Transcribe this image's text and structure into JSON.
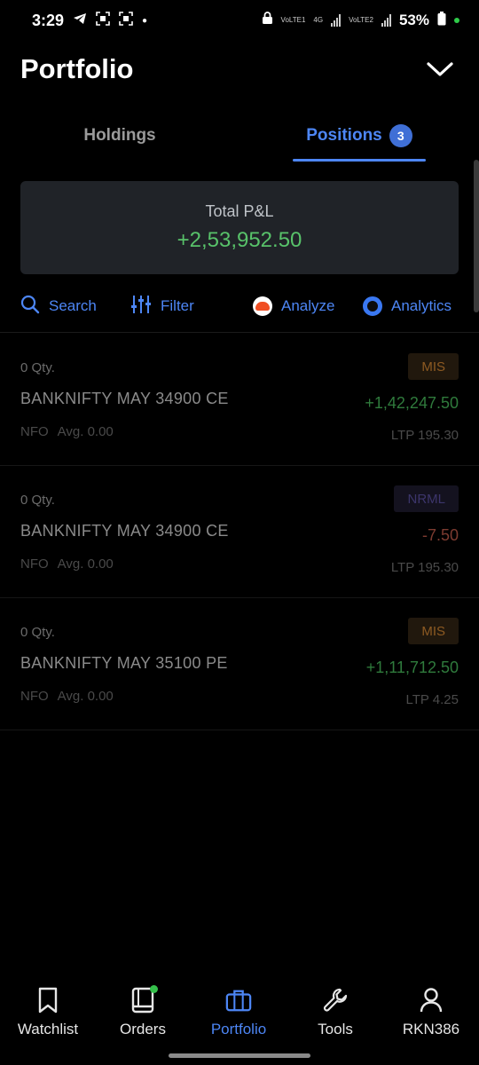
{
  "status_bar": {
    "time": "3:29",
    "network_1": "VoLTE1",
    "network_2": "4G",
    "network_3": "VoLTE2",
    "battery": "53%"
  },
  "header": {
    "title": "Portfolio"
  },
  "tabs": {
    "holdings": "Holdings",
    "positions": "Positions",
    "positions_count": "3"
  },
  "pnl": {
    "label": "Total P&L",
    "value": "+2,53,952.50"
  },
  "toolbar": {
    "search": "Search",
    "filter": "Filter",
    "analyze": "Analyze",
    "analytics": "Analytics"
  },
  "positions": [
    {
      "qty": "0 Qty.",
      "symbol": "BANKNIFTY MAY 34900 CE",
      "exchange": "NFO",
      "avg": "Avg. 0.00",
      "product": "MIS",
      "pnl": "+1,42,247.50",
      "ltp": "LTP 195.30"
    },
    {
      "qty": "0 Qty.",
      "symbol": "BANKNIFTY MAY 34900 CE",
      "exchange": "NFO",
      "avg": "Avg. 0.00",
      "product": "NRML",
      "pnl": "-7.50",
      "ltp": "LTP 195.30"
    },
    {
      "qty": "0 Qty.",
      "symbol": "BANKNIFTY MAY 35100 PE",
      "exchange": "NFO",
      "avg": "Avg. 0.00",
      "product": "MIS",
      "pnl": "+1,11,712.50",
      "ltp": "LTP 4.25"
    }
  ],
  "bottom_nav": {
    "watchlist": "Watchlist",
    "orders": "Orders",
    "portfolio": "Portfolio",
    "tools": "Tools",
    "account": "RKN386"
  },
  "colors": {
    "accent": "#4d86f5",
    "profit": "#58c26a",
    "loss": "#c0504d",
    "background": "#000000",
    "card": "#202328"
  }
}
